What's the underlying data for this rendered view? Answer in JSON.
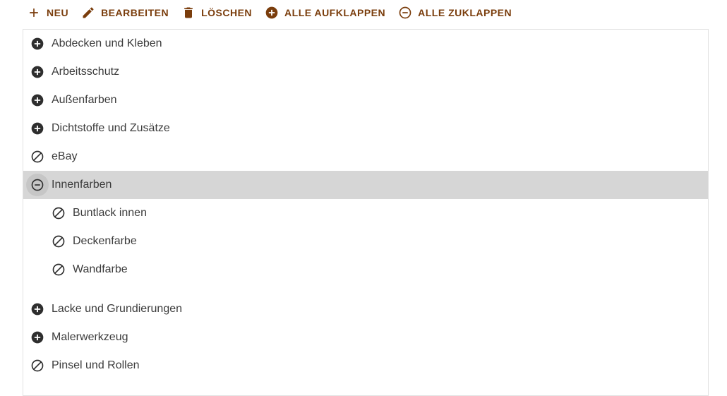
{
  "toolbar": {
    "new_label": "NEU",
    "edit_label": "BEARBEITEN",
    "delete_label": "LÖSCHEN",
    "expand_all_label": "ALLE AUFKLAPPEN",
    "collapse_all_label": "ALLE ZUKLAPPEN"
  },
  "colors": {
    "accent": "#7a3d0c",
    "text": "#3b3b3b",
    "icon": "#2e2e2e",
    "selected_bg": "#d6d6d6"
  },
  "tree": {
    "items": [
      {
        "label": "Abdecken und Kleben",
        "icon": "plus-circle-icon"
      },
      {
        "label": "Arbeitsschutz",
        "icon": "plus-circle-icon"
      },
      {
        "label": "Außenfarben",
        "icon": "plus-circle-icon"
      },
      {
        "label": "Dichtstoffe und Zusätze",
        "icon": "plus-circle-icon"
      },
      {
        "label": "eBay",
        "icon": "no-children-icon"
      },
      {
        "label": "Innenfarben",
        "icon": "minus-circle-icon",
        "selected": true,
        "children": [
          {
            "label": "Buntlack innen",
            "icon": "no-children-icon"
          },
          {
            "label": "Deckenfarbe",
            "icon": "no-children-icon"
          },
          {
            "label": "Wandfarbe",
            "icon": "no-children-icon"
          }
        ]
      },
      {
        "label": "Lacke und Grundierungen",
        "icon": "plus-circle-icon"
      },
      {
        "label": "Malerwerkzeug",
        "icon": "plus-circle-icon"
      },
      {
        "label": "Pinsel und Rollen",
        "icon": "no-children-icon"
      }
    ]
  }
}
